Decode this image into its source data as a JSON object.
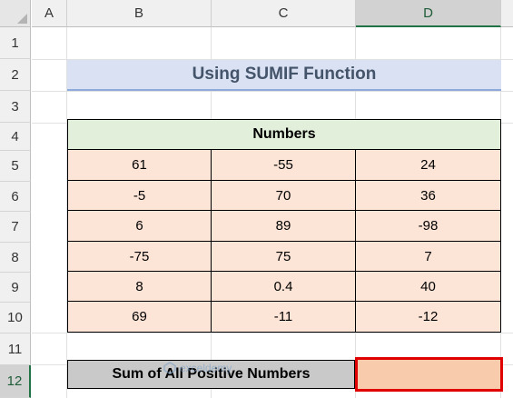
{
  "sheet": {
    "columns": [
      "A",
      "B",
      "C",
      "D"
    ],
    "rows": [
      "1",
      "2",
      "3",
      "4",
      "5",
      "6",
      "7",
      "8",
      "9",
      "10",
      "11",
      "12"
    ],
    "selected_column": "D",
    "selected_row": "12"
  },
  "title": "Using SUMIF Function",
  "table": {
    "header": "Numbers",
    "rows": [
      [
        "61",
        "-55",
        "24"
      ],
      [
        "-5",
        "70",
        "36"
      ],
      [
        "6",
        "89",
        "-98"
      ],
      [
        "-75",
        "75",
        "7"
      ],
      [
        "8",
        "0.4",
        "40"
      ],
      [
        "69",
        "-11",
        "-12"
      ]
    ]
  },
  "result_row": {
    "label": "Sum of All Positive Numbers",
    "value": ""
  },
  "watermark": "exceldemy",
  "colors": {
    "title_fill": "#d9e1f2",
    "header_fill": "#e2efda",
    "data_fill": "#fce4d6",
    "label_fill": "#c9c9c9",
    "result_fill": "#f8cbad",
    "highlight_border": "#e00000"
  }
}
